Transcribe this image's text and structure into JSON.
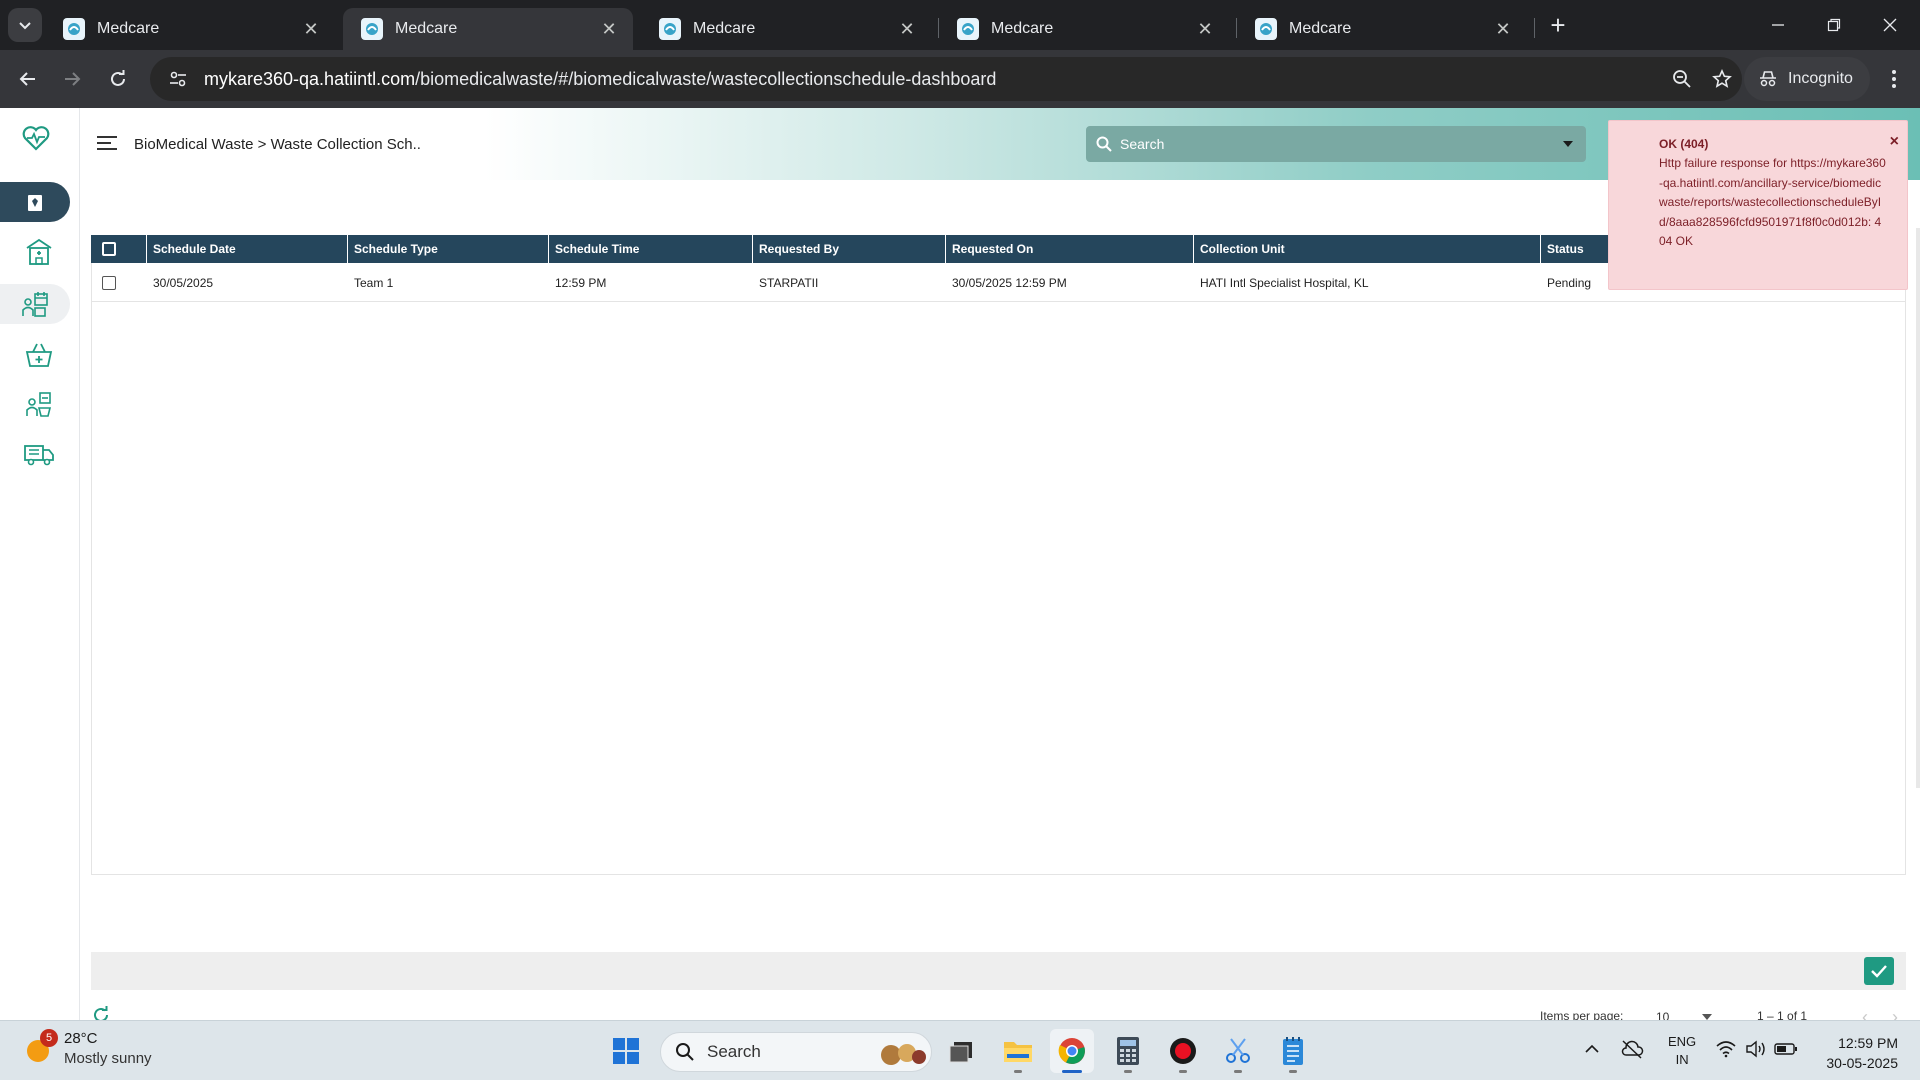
{
  "browser": {
    "tabs": [
      {
        "title": "Medcare",
        "active": false
      },
      {
        "title": "Medcare",
        "active": true
      },
      {
        "title": "Medcare",
        "active": false
      },
      {
        "title": "Medcare",
        "active": false
      },
      {
        "title": "Medcare",
        "active": false
      }
    ],
    "url_host": "mykare360-qa.hatiintl.com",
    "url_path": "/biomedicalwaste/#/biomedicalwaste/wastecollectionschedule-dashboard",
    "profile_label": "Incognito"
  },
  "app": {
    "breadcrumb": "BioMedical Waste > Waste Collection Sch..",
    "search_placeholder": "Search",
    "side_nav": [
      {
        "icon": "heartbeat-logo-icon",
        "active": false
      },
      {
        "icon": "waste-bin-icon",
        "active": true
      },
      {
        "icon": "hospital-building-icon",
        "active": false
      },
      {
        "icon": "collection-schedule-icon",
        "active": false
      },
      {
        "icon": "waste-basket-icon",
        "active": false
      },
      {
        "icon": "collection-staff-icon",
        "active": false
      },
      {
        "icon": "transport-truck-icon",
        "active": false
      }
    ]
  },
  "table": {
    "columns": [
      "Schedule Date",
      "Schedule Type",
      "Schedule Time",
      "Requested By",
      "Requested On",
      "Collection Unit",
      "Status"
    ],
    "rows": [
      {
        "schedule_date": "30/05/2025",
        "schedule_type": "Team 1",
        "schedule_time": "12:59 PM",
        "requested_by": "STARPATII",
        "requested_on": "30/05/2025 12:59 PM",
        "collection_unit": "HATI Intl Specialist Hospital, KL",
        "status": "Pending"
      }
    ]
  },
  "pager": {
    "items_per_page_label": "Items per page:",
    "items_per_page_value": "10",
    "range_label": "1 – 1 of 1"
  },
  "toast": {
    "title": "OK (404)",
    "message": "Http failure response for https://mykare360-qa.hatiintl.com/ancillary-service/biomedicwaste/reports/wastecollectionscheduleById/8aaa828596fcfd9501971f8f0c0d012b: 404 OK",
    "close": "×"
  },
  "taskbar": {
    "weather_badge": "5",
    "temperature": "28°C",
    "condition": "Mostly sunny",
    "search_label": "Search",
    "lang_line1": "ENG",
    "lang_line2": "IN",
    "time": "12:59 PM",
    "date": "30-05-2025"
  },
  "colors": {
    "header_bar": "#25465c",
    "accent": "#1f9a82",
    "toast_bg": "#f8d7da"
  }
}
